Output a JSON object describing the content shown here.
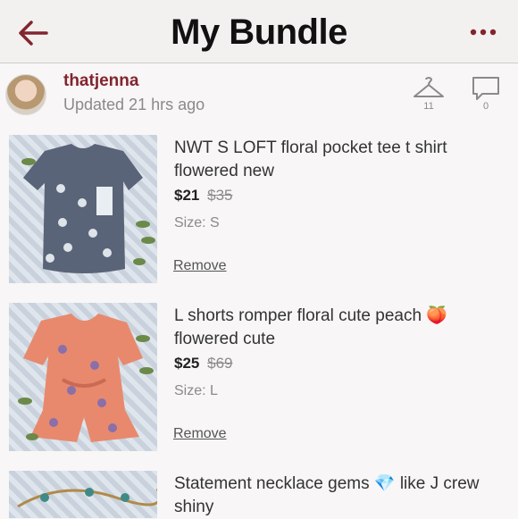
{
  "header": {
    "title": "My Bundle",
    "back_icon": "arrow-left-icon",
    "more_icon": "more-dots-icon",
    "accent": "#82252f"
  },
  "seller": {
    "username": "thatjenna",
    "updated": "Updated 21 hrs ago",
    "likes_count": "11",
    "comments_count": "0"
  },
  "items": [
    {
      "title": "NWT S LOFT floral pocket tee t shirt flowered new",
      "price": "$21",
      "original_price": "$35",
      "size": "Size: S",
      "remove_label": "Remove"
    },
    {
      "title": "L shorts romper floral cute peach 🍑 flowered cute",
      "price": "$25",
      "original_price": "$69",
      "size": "Size: L",
      "remove_label": "Remove"
    },
    {
      "title": "Statement necklace gems 💎 like J crew shiny"
    }
  ]
}
